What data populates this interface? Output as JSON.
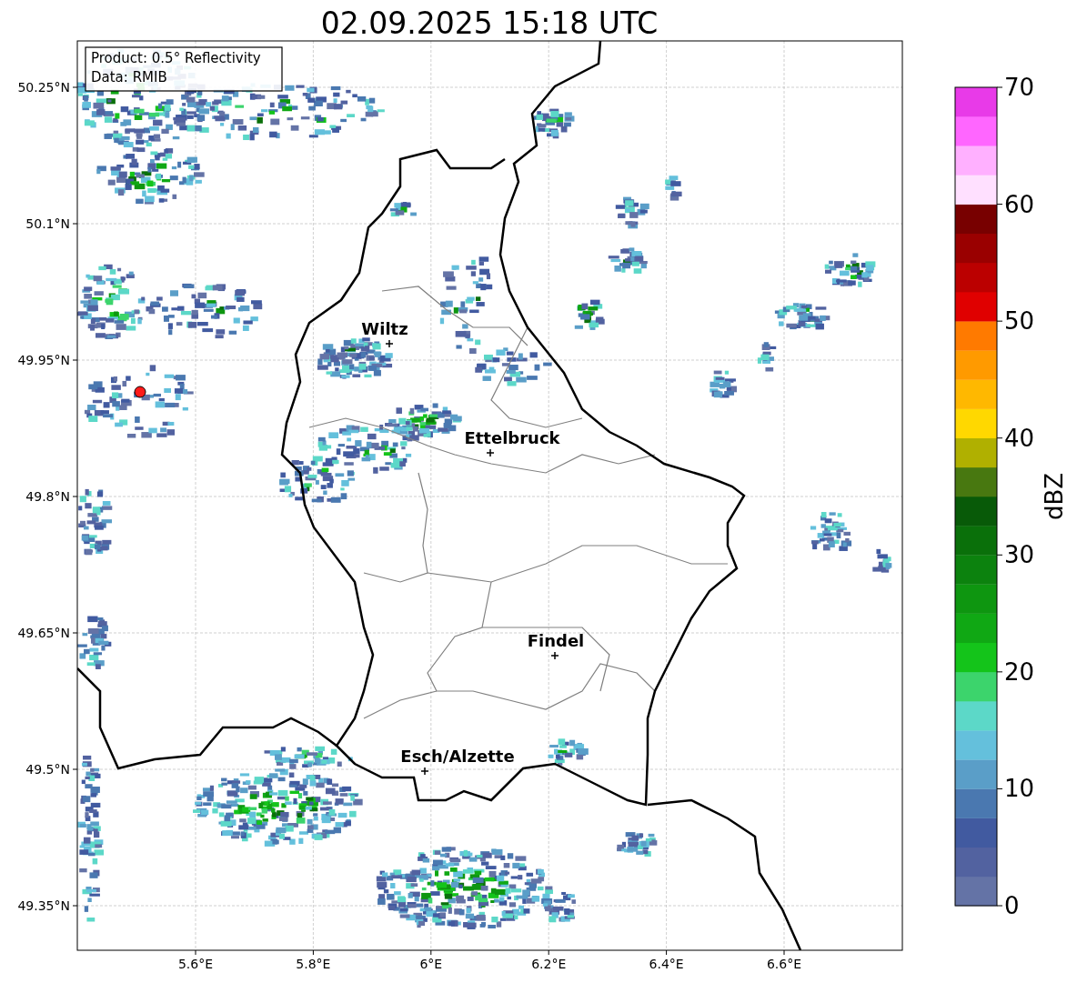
{
  "title": "02.09.2025 15:18 UTC",
  "info_box": [
    "Product: 0.5° Reflectivity",
    "Data: RMIB"
  ],
  "cities": [
    {
      "name": "Wiltz"
    },
    {
      "name": "Ettelbruck"
    },
    {
      "name": "Findel"
    },
    {
      "name": "Esch/Alzette"
    }
  ],
  "x_ticks": [
    "5.6°E",
    "5.8°E",
    "6°E",
    "6.2°E",
    "6.4°E",
    "6.6°E"
  ],
  "y_ticks": [
    "50.25°N",
    "50.1°N",
    "49.95°N",
    "49.8°N",
    "49.65°N",
    "49.5°N",
    "49.35°N"
  ],
  "colorbar": {
    "label": "dBZ",
    "ticks": [
      "70",
      "60",
      "50",
      "40",
      "30",
      "20",
      "10",
      "0"
    ],
    "bins": [
      {
        "color": "#6473a6"
      },
      {
        "color": "#5262a0"
      },
      {
        "color": "#415aa0"
      },
      {
        "color": "#4a78b0"
      },
      {
        "color": "#5a9ec8"
      },
      {
        "color": "#64c0dc"
      },
      {
        "color": "#5cd8c8"
      },
      {
        "color": "#3cd46c"
      },
      {
        "color": "#14c41a"
      },
      {
        "color": "#10a814"
      },
      {
        "color": "#0e9610"
      },
      {
        "color": "#0c820e"
      },
      {
        "color": "#0a700a"
      },
      {
        "color": "#085a08"
      },
      {
        "color": "#487810"
      },
      {
        "color": "#b0b000"
      },
      {
        "color": "#ffd800"
      },
      {
        "color": "#ffb800"
      },
      {
        "color": "#ff9a00"
      },
      {
        "color": "#ff7a00"
      },
      {
        "color": "#e00000"
      },
      {
        "color": "#bb0000"
      },
      {
        "color": "#9a0000"
      },
      {
        "color": "#780000"
      },
      {
        "color": "#ffe0ff"
      },
      {
        "color": "#ffb0ff"
      },
      {
        "color": "#ff66ff"
      },
      {
        "color": "#e83ae8"
      }
    ]
  }
}
